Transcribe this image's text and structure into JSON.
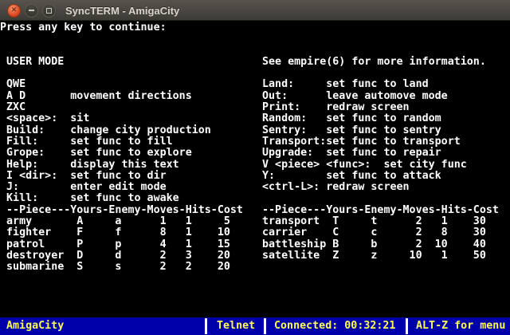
{
  "window": {
    "title": "SyncTERM - AmigaCity",
    "controls": {
      "close_glyph": "✕"
    }
  },
  "terminal": {
    "lines": [
      "Press any key to continue:",
      "",
      "",
      " USER MODE                               See empire(6) for more information.",
      "",
      " QWE                                     Land:     set func to land",
      " A D       movement directions           Out:      leave automove mode",
      " ZXC                                     Print:    redraw screen",
      " <space>:  sit                           Random:   set func to random",
      " Build:    change city production        Sentry:   set func to sentry",
      " Fill:     set func to fill              Transport:set func to transport",
      " Grope:    set func to explore           Upgrade:  set func to repair",
      " Help:     display this text             V <piece> <func>:  set city func",
      " I <dir>:  set func to dir               Y:        set func to attack",
      " J:        enter edit mode               <ctrl-L>: redraw screen",
      " Kill:     set func to awake",
      " --Piece---Yours-Enemy-Moves-Hits-Cost   --Piece---Yours-Enemy-Moves-Hits-Cost",
      " army       A     a      1   1     5     transport  T     t      2   1    30",
      " fighter    F     f      8   1    10     carrier    C     c      2   8    30",
      " patrol     P     p      4   1    15     battleship B     b      2  10    40",
      " destroyer  D     d      2   3    20     satellite  Z     z     10   1    50",
      " submarine  S     s      2   2    20"
    ]
  },
  "status_bar": {
    "bbs_name": "AmigaCity",
    "protocol": "Telnet",
    "connected": "Connected: 00:32:21",
    "menu_hint": "ALT-Z for menu"
  },
  "colors": {
    "terminal_bg": "#000000",
    "terminal_fg": "#ffffff",
    "status_bg": "#0000aa",
    "status_fg": "#fcfc55",
    "separator": "#fcfcfc",
    "close_btn": "#dd4a22"
  }
}
